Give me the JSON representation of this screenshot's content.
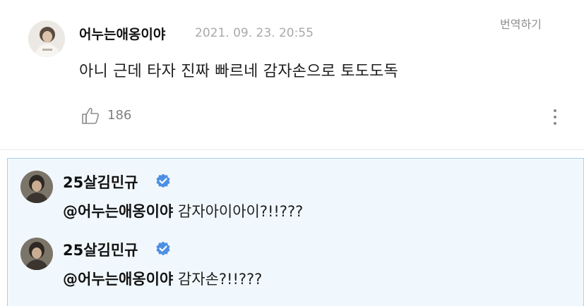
{
  "comment": {
    "author": "어누는애옹이야",
    "date": "2021. 09. 23. 20:55",
    "translate_label": "번역하기",
    "text": "아니 근데 타자 진짜 빠르네 감자손으로 토도도독",
    "likes": "186",
    "icons": {
      "like": "thumbs-up-icon",
      "more": "more-vertical-icon"
    }
  },
  "replies": [
    {
      "author": "25살김민규",
      "verified": true,
      "mention": "@어누는애옹이야",
      "text": " 감자아이아이?!!???"
    },
    {
      "author": "25살김민규",
      "verified": true,
      "mention": "@어누는애옹이야",
      "text": " 감자손?!!???"
    }
  ],
  "colors": {
    "verified_badge": "#4d8fe4",
    "reply_bg": "#f1f8fd",
    "reply_border": "#a6d1ef"
  }
}
